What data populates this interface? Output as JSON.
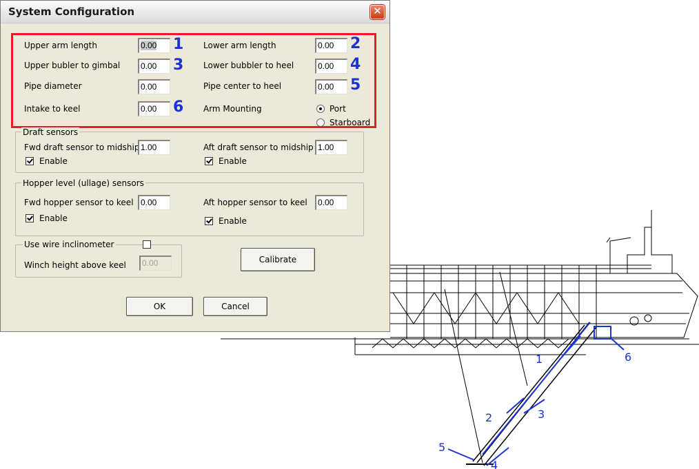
{
  "window": {
    "title": "System Configuration",
    "close_glyph": "✕"
  },
  "arm": {
    "upper_arm_length": {
      "label": "Upper arm length",
      "value": "0.00",
      "callout": "1"
    },
    "lower_arm_length": {
      "label": "Lower arm length",
      "value": "0.00",
      "callout": "2"
    },
    "upper_bubbler_to_gimbal": {
      "label": "Upper bubler to gimbal",
      "value": "0.00",
      "callout": "3"
    },
    "lower_bubbler_to_heel": {
      "label": "Lower bubbler to heel",
      "value": "0.00",
      "callout": "4"
    },
    "pipe_diameter": {
      "label": "Pipe diameter",
      "value": "0.00"
    },
    "pipe_center_to_heel": {
      "label": "Pipe center to heel",
      "value": "0.00",
      "callout": "5"
    },
    "intake_to_keel": {
      "label": "Intake to keel",
      "value": "0.00",
      "callout": "6"
    },
    "arm_mounting": {
      "label": "Arm Mounting",
      "options": [
        "Port",
        "Starboard"
      ],
      "selected": "Port"
    }
  },
  "draft_sensors": {
    "title": "Draft sensors",
    "fwd": {
      "label": "Fwd draft sensor to midship",
      "value": "1.00",
      "enable_label": "Enable",
      "enabled": true
    },
    "aft": {
      "label": "Aft draft sensor to midship",
      "value": "1.00",
      "enable_label": "Enable",
      "enabled": true
    }
  },
  "hopper_sensors": {
    "title": "Hopper level (ullage) sensors",
    "fwd": {
      "label": "Fwd hopper sensor to keel",
      "value": "0.00",
      "enable_label": "Enable",
      "enabled": true
    },
    "aft": {
      "label": "Aft hopper sensor to keel",
      "value": "0.00",
      "enable_label": "Enable",
      "enabled": true
    }
  },
  "wire_inclinometer": {
    "title": "Use wire inclinometer",
    "checked": false,
    "winch_label": "Winch height above keel",
    "winch_value": "0.00"
  },
  "buttons": {
    "calibrate": "Calibrate",
    "ok": "OK",
    "cancel": "Cancel"
  },
  "diagram_labels": {
    "l1": "1",
    "l2": "2",
    "l3": "3",
    "l4": "4",
    "l5": "5",
    "l6": "6"
  },
  "colors": {
    "callout": "#1b33d6",
    "highlight": "#e61c2b",
    "dialog_bg": "#ece9d8"
  }
}
